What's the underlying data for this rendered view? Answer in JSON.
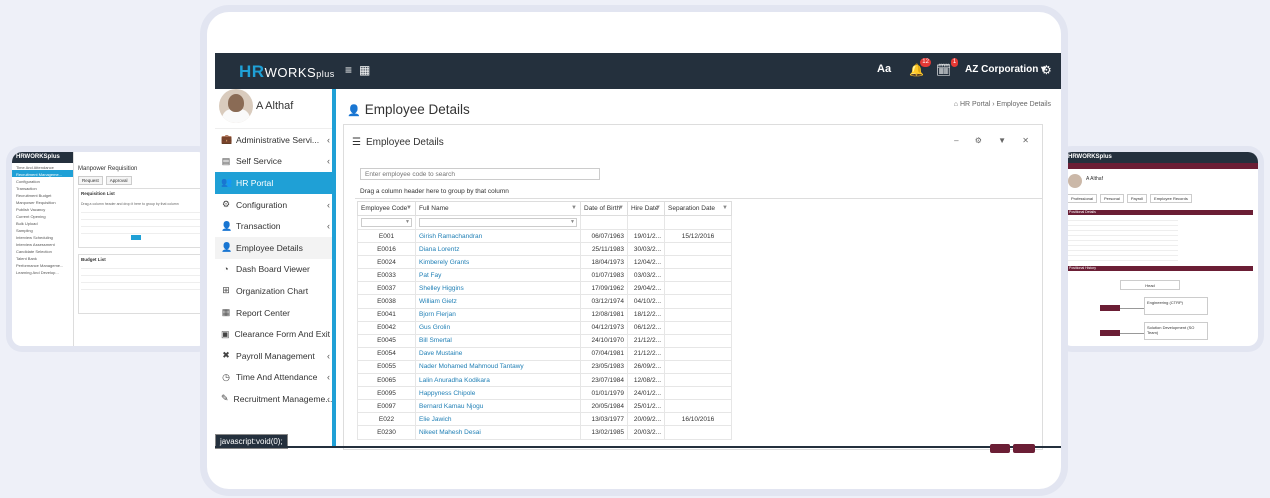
{
  "left_preview": {
    "logo": "HRWORKSplus",
    "nav": [
      "Time And Attendance",
      "Recruitment Manageme...",
      "Configuration",
      "Transaction",
      "Recruitment Budget",
      "Manpower Requisition",
      "Publish Vacancy",
      "Current Opening",
      "Bulk Upload",
      "Sampling",
      "Interview Scheduling",
      "Interview Assessment",
      "Candidate Selection",
      "Talent Bank",
      "Performance Manageme...",
      "Learning And Develop..."
    ],
    "title": "Manpower Requisition",
    "tabs": [
      "Request",
      "Approval"
    ],
    "section1": "Requisition List",
    "section2": "Budget List",
    "drag_text": "Drag a column header and drop it here to group by that column"
  },
  "right_preview": {
    "logo": "HRWORKSplus",
    "user": "A Althaf",
    "tabs": [
      "Professional",
      "Personal",
      "Payroll",
      "Employee Records"
    ],
    "sec1": "Positional Details",
    "sec2": "Positional History",
    "node1": "Head",
    "node2": "Engineering (CTRP)",
    "node3": "Solution Development (SO Team)"
  },
  "topbar": {
    "logo_hr": "HR",
    "logo_works": "WORKS",
    "logo_plus": "plus",
    "font_icon": "Aa",
    "notif_count": "12",
    "task_count": "1",
    "company": "AZ Corporation ▾"
  },
  "sidebar": {
    "user_name": "A Althaf",
    "items": [
      {
        "label": "Administrative Servi...",
        "icon": "briefcase-icon",
        "glyph": "💼",
        "chev": "‹"
      },
      {
        "label": "Self Service",
        "icon": "id-card-icon",
        "glyph": "▤",
        "chev": "‹"
      },
      {
        "label": "HR Portal",
        "icon": "users-icon",
        "glyph": "👥",
        "chev": ""
      },
      {
        "label": "Configuration",
        "icon": "gear-icon",
        "glyph": "⚙",
        "chev": "‹"
      },
      {
        "label": "Transaction",
        "icon": "user-icon",
        "glyph": "👤",
        "chev": "‹"
      },
      {
        "label": "Employee Details",
        "icon": "user-icon",
        "glyph": "👤",
        "chev": ""
      },
      {
        "label": "Dash Board Viewer",
        "icon": "chart-icon",
        "glyph": "◔",
        "chev": ""
      },
      {
        "label": "Organization Chart",
        "icon": "sitemap-icon",
        "glyph": "⊞",
        "chev": ""
      },
      {
        "label": "Report Center",
        "icon": "report-icon",
        "glyph": "▦",
        "chev": ""
      },
      {
        "label": "Clearance Form And Exit Intervi",
        "icon": "file-icon",
        "glyph": "▣",
        "chev": ""
      },
      {
        "label": "Payroll Management",
        "icon": "payroll-icon",
        "glyph": "✖",
        "chev": "‹"
      },
      {
        "label": "Time And Attendance",
        "icon": "clock-icon",
        "glyph": "◷",
        "chev": "‹"
      },
      {
        "label": "Recruitment Manageme...",
        "icon": "recruit-icon",
        "glyph": "✎",
        "chev": "‹"
      }
    ],
    "status_text": "javascript:void(0);"
  },
  "page": {
    "title": "Employee Details",
    "breadcrumb_home": "HR Portal",
    "breadcrumb_sep": "›",
    "breadcrumb_current": "Employee Details",
    "panel_title": "Employee Details",
    "search_placeholder": "Enter employee code to search",
    "group_hint": "Drag a column header here to group by that column",
    "tools": "– ⚙ ▼ ✕"
  },
  "grid": {
    "columns": [
      "Employee Code",
      "Full Name",
      "Date of Birth",
      "Hire Date",
      "Separation Date"
    ],
    "rows": [
      [
        "E001",
        "Girish Ramachandran",
        "06/07/1963",
        "19/01/2...",
        "15/12/2016"
      ],
      [
        "E0016",
        "Diana Lorentz",
        "25/11/1983",
        "30/03/2...",
        ""
      ],
      [
        "E0024",
        "Kimberely Grants",
        "18/04/1973",
        "12/04/2...",
        ""
      ],
      [
        "E0033",
        "Pat Fay",
        "01/07/1983",
        "03/03/2...",
        ""
      ],
      [
        "E0037",
        "Shelley Higgins",
        "17/09/1962",
        "29/04/2...",
        ""
      ],
      [
        "E0038",
        "William Gietz",
        "03/12/1974",
        "04/10/2...",
        ""
      ],
      [
        "E0041",
        "Bjorn Flerjan",
        "12/08/1981",
        "18/12/2...",
        ""
      ],
      [
        "E0042",
        "Gus Grolin",
        "04/12/1973",
        "06/12/2...",
        ""
      ],
      [
        "E0045",
        "Bill Smertal",
        "24/10/1970",
        "21/12/2...",
        ""
      ],
      [
        "E0054",
        "Dave Mustaine",
        "07/04/1981",
        "21/12/2...",
        ""
      ],
      [
        "E0055",
        "Nader Mohamed Mahmoud Tantawy",
        "23/05/1983",
        "26/09/2...",
        ""
      ],
      [
        "E0065",
        "Lalin Anuradha Kodikara",
        "23/07/1984",
        "12/08/2...",
        ""
      ],
      [
        "E0095",
        "Happyness Chipole",
        "01/01/1979",
        "24/01/2...",
        ""
      ],
      [
        "E0097",
        "Bernard Kamau Njogu",
        "20/05/1984",
        "25/01/2...",
        ""
      ],
      [
        "E022",
        "Elie Jawich",
        "13/03/1977",
        "20/09/2...",
        "16/10/2016"
      ],
      [
        "E0230",
        "Nikeet Mahesh Desai",
        "13/02/1985",
        "20/03/2...",
        ""
      ]
    ]
  },
  "colors": {
    "dark": "#24303d",
    "accent": "#1fa0d6",
    "maroon": "#6b1e35",
    "link": "#1f7fb5"
  }
}
